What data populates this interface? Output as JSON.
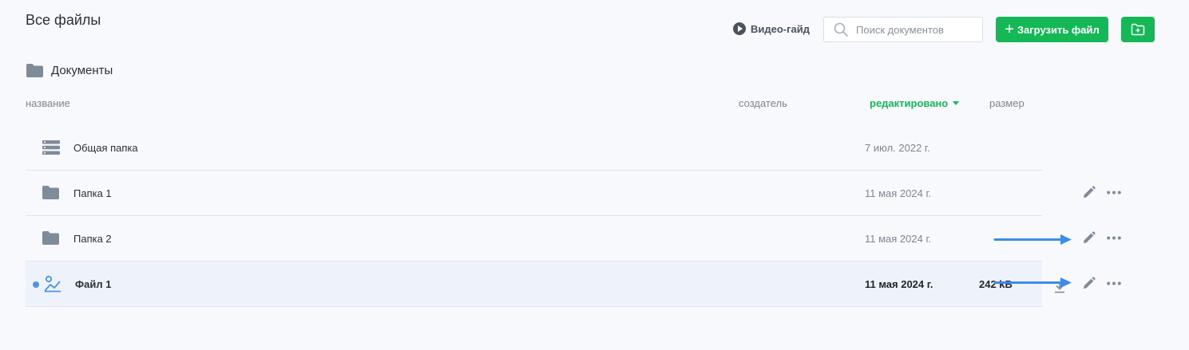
{
  "page": {
    "title": "Все файлы"
  },
  "toolbar": {
    "video_guide_label": "Видео-гайд",
    "search_placeholder": "Поиск документов",
    "search_value": "",
    "upload_label": "Загрузить файл",
    "brand_color": "#15b857"
  },
  "breadcrumb": {
    "label": "Документы"
  },
  "columns": {
    "name": "название",
    "creator": "создатель",
    "edited": "редактировано",
    "size": "размер"
  },
  "rows": [
    {
      "name": "Общая папка",
      "icon": "shared-storage-icon",
      "creator": "",
      "edited": "7 июл. 2022 г.",
      "size": ""
    },
    {
      "name": "Папка 1",
      "icon": "folder-icon",
      "creator": "",
      "edited": "11 мая 2024 г.",
      "size": ""
    },
    {
      "name": "Папка 2",
      "icon": "folder-icon",
      "creator": "",
      "edited": "11 мая 2024 г.",
      "size": ""
    },
    {
      "name": "Файл 1",
      "icon": "image-file-icon",
      "creator": "",
      "edited": "11 мая 2024 г.",
      "size": "242 kB",
      "selected": true
    }
  ]
}
